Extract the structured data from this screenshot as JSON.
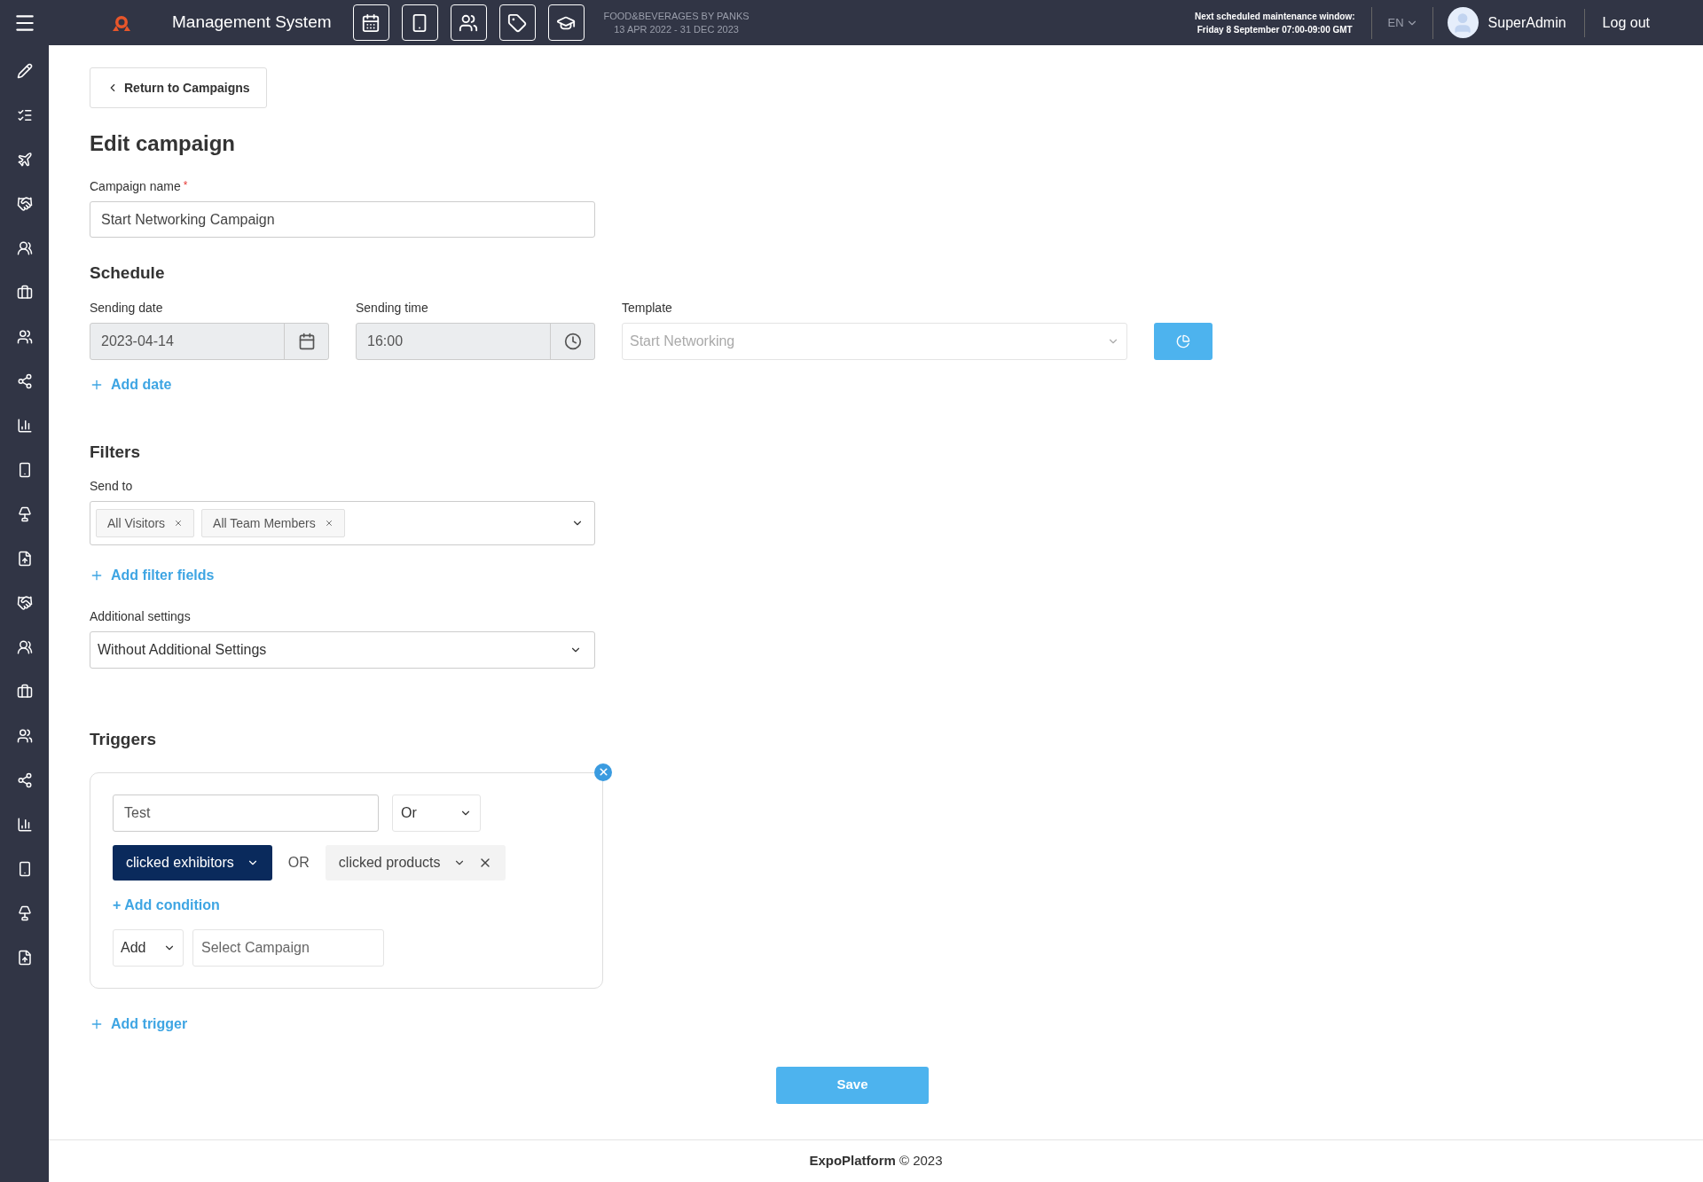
{
  "topbar": {
    "title": "Management System",
    "event_name": "FOOD&BEVERAGES BY PANKS",
    "event_dates": "13 APR 2022 - 31 DEC 2023",
    "maintenance_line1": "Next scheduled maintenance window:",
    "maintenance_line2": "Friday 8 September 07:00-09:00 GMT",
    "language": "EN",
    "user": "SuperAdmin",
    "logout": "Log out"
  },
  "back_button": "Return to Campaigns",
  "heading": "Edit campaign",
  "campaign_name": {
    "label": "Campaign name",
    "required_mark": "*",
    "value": "Start Networking Campaign"
  },
  "schedule": {
    "title": "Schedule",
    "date_label": "Sending date",
    "date_value": "2023-04-14",
    "time_label": "Sending time",
    "time_value": "16:00",
    "template_label": "Template",
    "template_placeholder": "Start Networking",
    "add_date": "Add date"
  },
  "filters": {
    "title": "Filters",
    "send_to_label": "Send to",
    "tags": [
      "All Visitors",
      "All Team Members"
    ],
    "add_filter": "Add filter fields",
    "additional_label": "Additional settings",
    "additional_value": "Without Additional Settings"
  },
  "triggers": {
    "title": "Triggers",
    "name_value": "Test",
    "operator": "Or",
    "conditions": [
      {
        "label": "clicked exhibitors",
        "selected": true
      },
      {
        "label": "clicked products",
        "selected": false
      }
    ],
    "connector": "OR",
    "add_condition": "+ Add condition",
    "action": "Add",
    "campaign_placeholder": "Select Campaign",
    "add_trigger": "Add trigger"
  },
  "save": "Save",
  "footer": {
    "brand": "ExpoPlatform",
    "copyright": "© 2023"
  }
}
